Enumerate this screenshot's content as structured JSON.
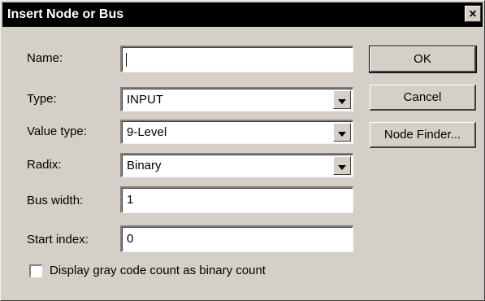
{
  "window": {
    "title": "Insert Node or Bus",
    "close_glyph": "×"
  },
  "form": {
    "name_label": "Name:",
    "name_value": "",
    "type_label": "Type:",
    "type_value": "INPUT",
    "value_type_label": "Value type:",
    "value_type_value": "9-Level",
    "radix_label": "Radix:",
    "radix_value": "Binary",
    "bus_width_label": "Bus width:",
    "bus_width_value": "1",
    "start_index_label": "Start index:",
    "start_index_value": "0",
    "gray_code_label": "Display gray code count as binary count",
    "gray_code_checked": false
  },
  "buttons": {
    "ok": "OK",
    "cancel": "Cancel",
    "node_finder": "Node Finder..."
  },
  "icons": {
    "close": "close-icon",
    "dropdown": "chevron-down-icon"
  }
}
